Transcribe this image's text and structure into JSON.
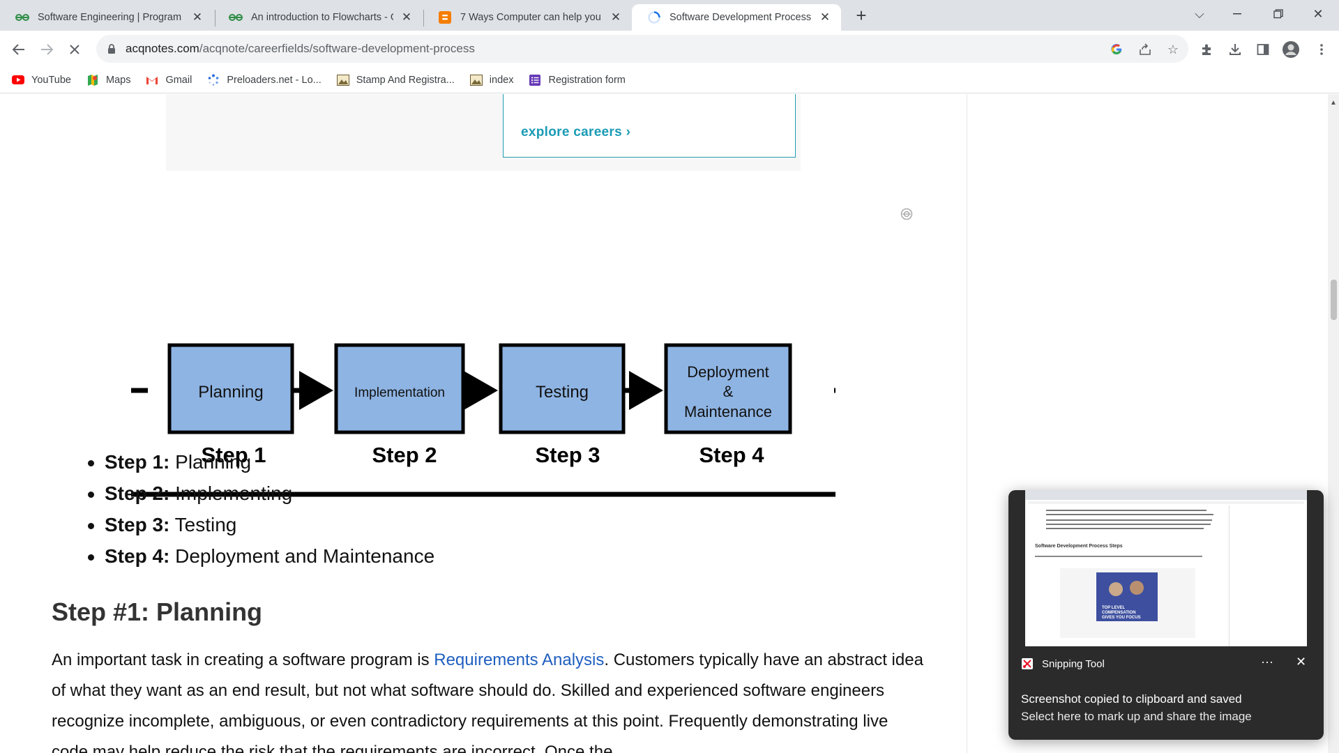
{
  "tabs": [
    {
      "title": "Software Engineering | Program"
    },
    {
      "title": "An introduction to Flowcharts - G"
    },
    {
      "title": "7 Ways Computer can help you"
    },
    {
      "title": "Software Development Process"
    }
  ],
  "address": {
    "domain": "acqnotes.com",
    "path": "/acqnote/careerfields/software-development-process"
  },
  "bookmarks": [
    {
      "label": "YouTube"
    },
    {
      "label": "Maps"
    },
    {
      "label": "Gmail"
    },
    {
      "label": "Preloaders.net - Lo..."
    },
    {
      "label": "Stamp And Registra..."
    },
    {
      "label": "index"
    },
    {
      "label": "Registration form"
    }
  ],
  "ad": {
    "link_text": "explore careers ›"
  },
  "diagram": {
    "boxes": [
      {
        "label_lines": [
          "Planning"
        ],
        "step": "Step 1"
      },
      {
        "label_lines": [
          "Implementation"
        ],
        "step": "Step 2"
      },
      {
        "label_lines": [
          "Testing"
        ],
        "step": "Step 3"
      },
      {
        "label_lines": [
          "Deployment",
          "&",
          "Maintenance"
        ],
        "step": "Step 4"
      }
    ]
  },
  "steps_list": [
    {
      "label": "Step 1:",
      "text": " Planning"
    },
    {
      "label": "Step 2:",
      "text": " Implementing"
    },
    {
      "label": "Step 3:",
      "text": " Testing"
    },
    {
      "label": "Step 4:",
      "text": " Deployment and Maintenance"
    }
  ],
  "section": {
    "heading": "Step #1: Planning",
    "para_before_link": "An important task in creating a software program is ",
    "link": "Requirements Analysis",
    "para_after_link": ". Customers typically have an abstract idea of what they want as an end result, but not what software should do. Skilled and experienced software engineers recognize incomplete, ambiguous, or even contradictory requirements at this point. Frequently demonstrating live code may help reduce the risk that the requirements are incorrect. Once the"
  },
  "toast": {
    "app": "Snipping Tool",
    "more": "···",
    "title": "Screenshot copied to clipboard and saved",
    "body": "Select here to mark up and share the image",
    "preview": {
      "heading": "Software Development Process Steps",
      "ad_lines": [
        "TOP LEVEL",
        "COMPENSATION",
        "GIVES YOU FOCUS"
      ]
    }
  },
  "colors": {
    "accent_teal": "#1a9bb5",
    "diagram_box": "#8eb4e3",
    "link": "#1f5fbf"
  }
}
